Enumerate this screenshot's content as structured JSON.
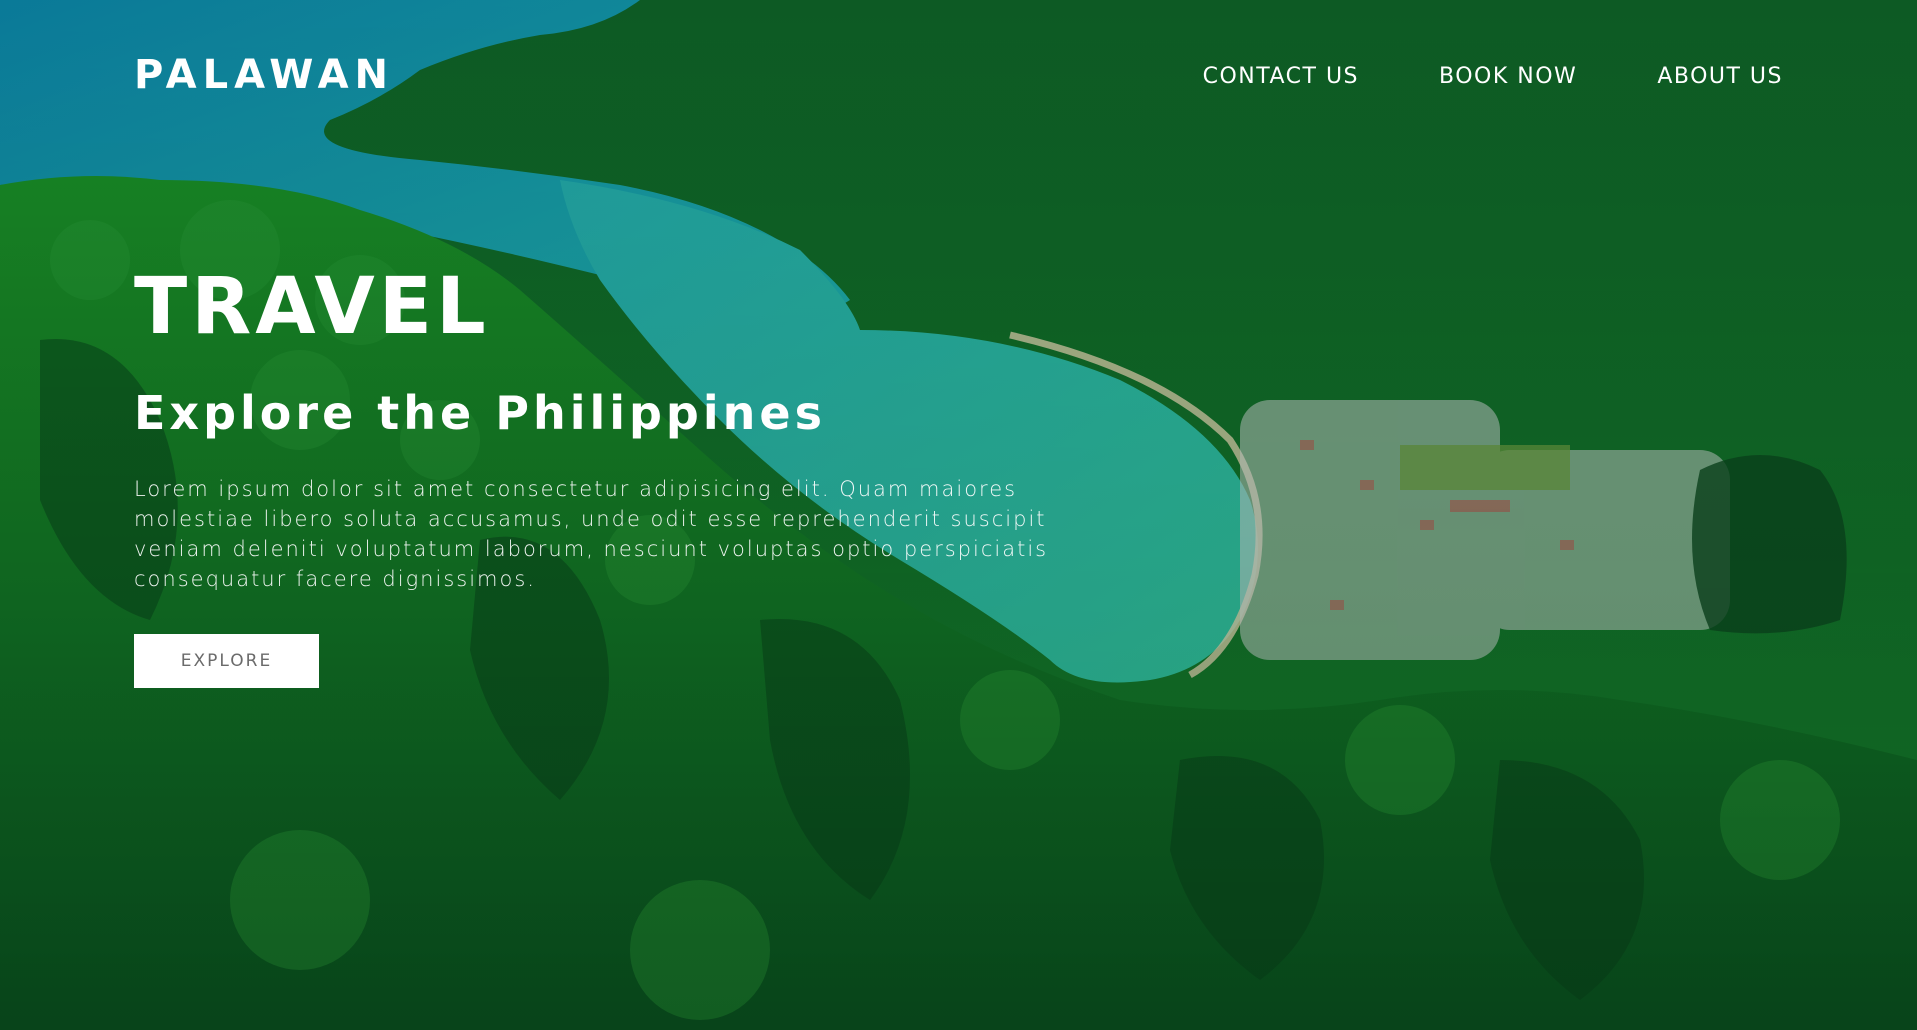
{
  "brand": {
    "name": "PALAWAN"
  },
  "nav": {
    "items": [
      {
        "label": "CONTACT US"
      },
      {
        "label": "BOOK NOW"
      },
      {
        "label": "ABOUT US"
      }
    ]
  },
  "hero": {
    "title": "TRAVEL",
    "subtitle": "Explore the Philippines",
    "description": "Lorem ipsum dolor sit amet consectetur adipisicing elit. Quam maiores molestiae libero soluta accusamus, unde odit esse reprehenderit suscipit veniam deleniti voluptatum laborum, nesciunt voluptas optio perspiciatis consequatur facere dignissimos.",
    "cta_label": "EXPLORE"
  },
  "background": {
    "description_icon": "aerial-landscape-image",
    "colors": {
      "sea": "#1aa7b8",
      "lagoon": "#2fc9b0",
      "forest": "#118a2a",
      "dark_forest": "#0b4f24"
    }
  }
}
